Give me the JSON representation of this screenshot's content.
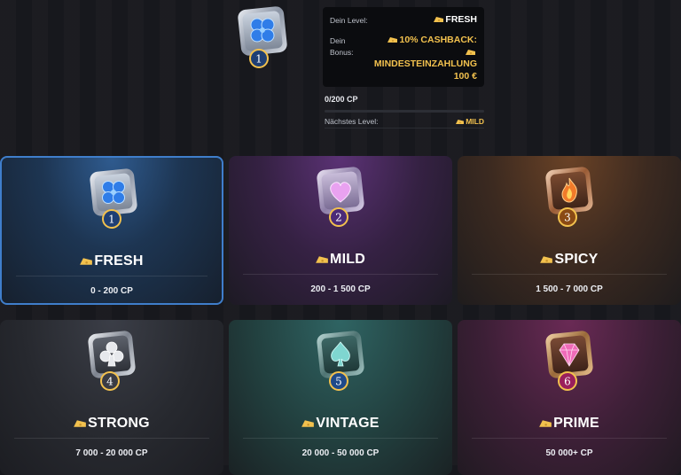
{
  "current": {
    "level_label": "Dein Level:",
    "level_value": "FRESH",
    "bonus_label_line1": "Dein",
    "bonus_label_line2": "Bonus:",
    "bonus_line1": "10% CASHBACK:",
    "bonus_line2": "MINDESTEINZAHLUNG",
    "bonus_line3": "100 €",
    "badge_number": "1",
    "progress_text": "0/200 CP",
    "progress_fraction": 0.0,
    "next_label": "Nächstes Level:",
    "next_value": "MILD"
  },
  "colors": {
    "accent_gold": "#f2c14e",
    "active_border": "#3f7ecb"
  },
  "tiers": [
    {
      "name": "FRESH",
      "range": "0 - 200 CP",
      "number": "1",
      "icon": "clover-icon",
      "active": true,
      "bg_color": "#1e3a5c",
      "ring_color": "#1f3f74"
    },
    {
      "name": "MILD",
      "range": "200 - 1 500 CP",
      "number": "2",
      "icon": "heart-icon",
      "active": false,
      "bg_color": "#3a2448",
      "ring_color": "#4b2a78"
    },
    {
      "name": "SPICY",
      "range": "1 500 - 7 000 CP",
      "number": "3",
      "icon": "flame-icon",
      "active": false,
      "bg_color": "#4a2f1e",
      "ring_color": "#8a4a14"
    },
    {
      "name": "STRONG",
      "range": "7 000 - 20 000 CP",
      "number": "4",
      "icon": "club-icon",
      "active": false,
      "bg_color": "#2a2c33",
      "ring_color": "#3a3c44"
    },
    {
      "name": "VINTAGE",
      "range": "20 000 - 50 000 CP",
      "number": "5",
      "icon": "spade-icon",
      "active": false,
      "bg_color": "#1f3d3f",
      "ring_color": "#1f4a8a"
    },
    {
      "name": "PRIME",
      "range": "50 000+ CP",
      "number": "6",
      "icon": "diamond-icon",
      "active": false,
      "bg_color": "#4a1e3a",
      "ring_color": "#9a1f5c"
    }
  ]
}
